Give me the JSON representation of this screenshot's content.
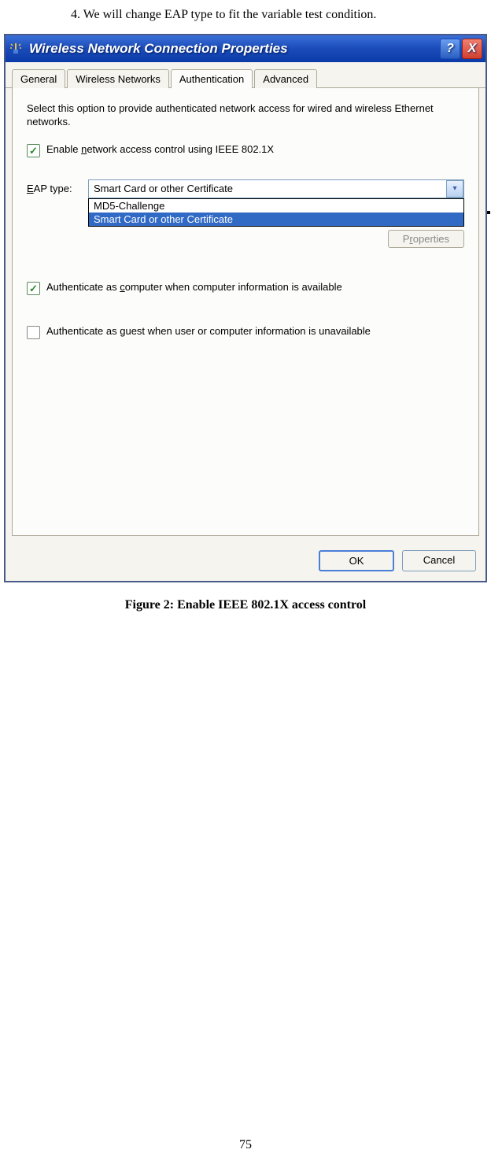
{
  "page": {
    "intro_text": "4. We will change EAP type to fit the variable test condition.",
    "figure_caption": "Figure 2: Enable IEEE 802.1X access control",
    "page_number": "75"
  },
  "titlebar": {
    "title": "Wireless Network Connection Properties",
    "help_label": "?",
    "close_label": "X"
  },
  "tabs": {
    "general": "General",
    "wireless": "Wireless Networks",
    "auth": "Authentication",
    "advanced": "Advanced"
  },
  "panel": {
    "description": "Select this option to provide authenticated network access for wired and wireless Ethernet networks.",
    "enable_prefix": "Enable ",
    "enable_underline": "n",
    "enable_suffix": "etwork access control using IEEE 802.1X",
    "eap_label_pre": "",
    "eap_label_u": "E",
    "eap_label_post": "AP type:",
    "combo_value": "Smart Card or other Certificate",
    "dropdown": {
      "opt1": "MD5-Challenge",
      "opt2": "Smart Card or other Certificate"
    },
    "properties_btn": "Properties",
    "auth_computer_pre": "Authenticate as ",
    "auth_computer_u": "c",
    "auth_computer_post": "omputer when computer information is available",
    "auth_guest_pre": "Authenticate as ",
    "auth_guest_u": "g",
    "auth_guest_post": "uest when user or computer information is unavailable"
  },
  "buttons": {
    "ok": "OK",
    "cancel": "Cancel"
  }
}
